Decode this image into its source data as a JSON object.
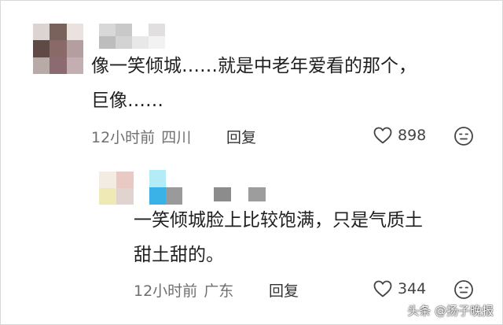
{
  "comments": [
    {
      "text_lines": [
        "像一笑倾城……就是中老年爱看的那个，",
        "巨像……"
      ],
      "time": "12小时前",
      "location": "四川",
      "reply_label": "回复",
      "likes": "898"
    },
    {
      "text_lines": [
        "一笑倾城脸上比较饱满，只是气质土",
        "甜土甜的。"
      ],
      "time": "12小时前",
      "location": "广东",
      "reply_label": "回复",
      "likes": "344"
    }
  ],
  "watermark": "头条 @扬子晚报",
  "icons": {
    "like": "heart-outline-icon",
    "reaction": "neutral-face-icon"
  },
  "colors": {
    "meta_text": "#6f6f6f",
    "body_text": "#1f1f1f"
  }
}
